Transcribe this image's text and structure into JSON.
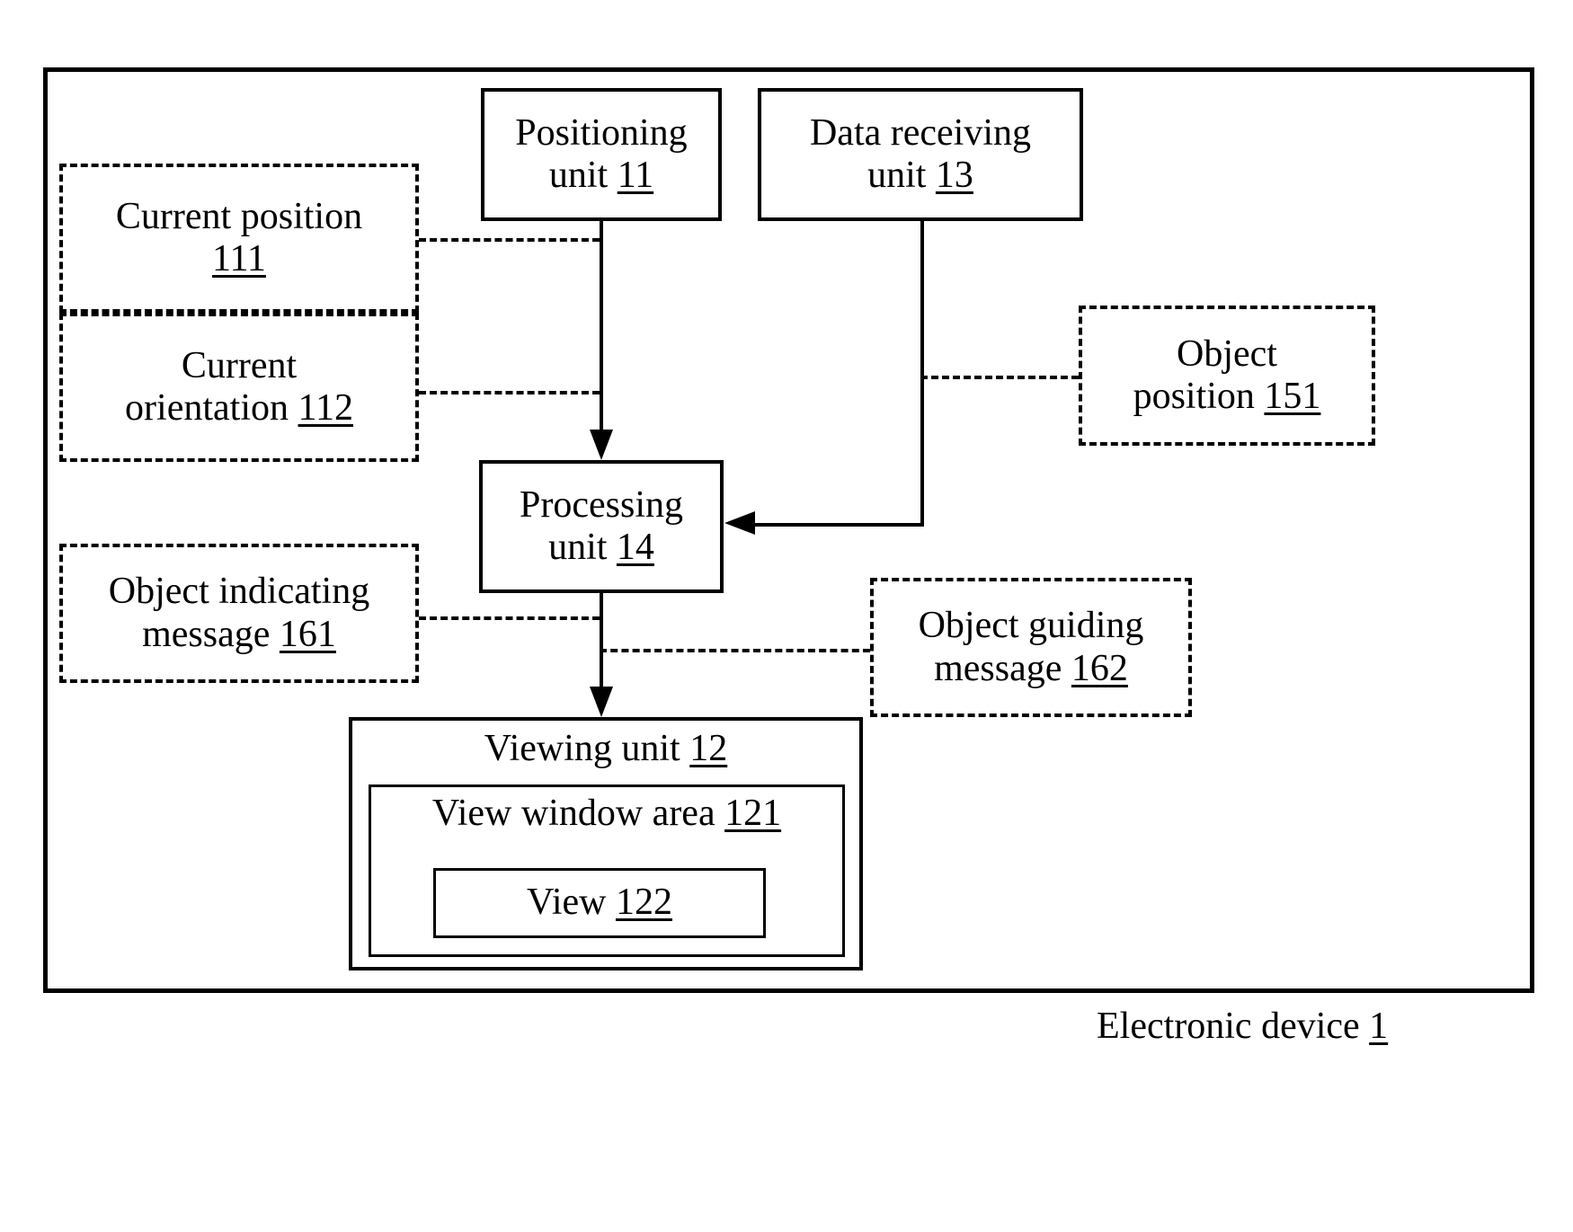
{
  "figure": {
    "frame_label": "Electronic device",
    "frame_number": "1"
  },
  "blocks": {
    "positioning_unit": {
      "line1": "Positioning",
      "line2": "unit",
      "number": "11"
    },
    "data_receiving_unit": {
      "line1": "Data receiving",
      "line2": "unit",
      "number": "13"
    },
    "processing_unit": {
      "line1": "Processing",
      "line2": "unit",
      "number": "14"
    },
    "viewing_unit": {
      "line1": "Viewing unit",
      "number": "12"
    },
    "view_window_area": {
      "line1": "View window area",
      "number": "121"
    },
    "view": {
      "line1": "View",
      "number": "122"
    },
    "current_position": {
      "line1": "Current position",
      "number": "111"
    },
    "current_orientation": {
      "line1": "Current",
      "line2": "orientation",
      "number": "112"
    },
    "object_position": {
      "line1": "Object",
      "line2": "position",
      "number": "151"
    },
    "object_indicating_message": {
      "line1": "Object indicating",
      "line2": "message",
      "number": "161"
    },
    "object_guiding_message": {
      "line1": "Object guiding",
      "line2": "message",
      "number": "162"
    }
  },
  "colors": {
    "stroke": "#000000",
    "background": "#ffffff"
  }
}
